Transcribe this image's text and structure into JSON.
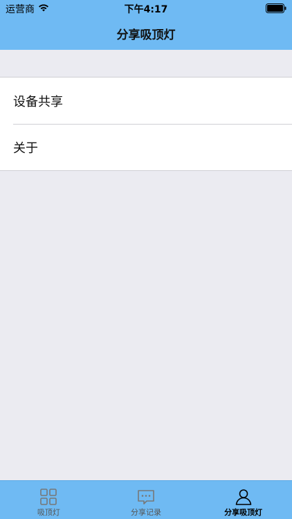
{
  "status_bar": {
    "carrier": "运营商",
    "time": "下午4:17"
  },
  "nav": {
    "title": "分享吸顶灯"
  },
  "list": {
    "items": [
      {
        "label": "设备共享"
      },
      {
        "label": "关于"
      }
    ]
  },
  "tab_bar": {
    "tabs": [
      {
        "label": "吸顶灯",
        "icon": "grid-icon",
        "active": false
      },
      {
        "label": "分享记录",
        "icon": "chat-bubble-icon",
        "active": false
      },
      {
        "label": "分享吸顶灯",
        "icon": "person-icon",
        "active": true
      }
    ]
  },
  "colors": {
    "accent": "#6fbaf3",
    "background": "#ebebf1"
  }
}
